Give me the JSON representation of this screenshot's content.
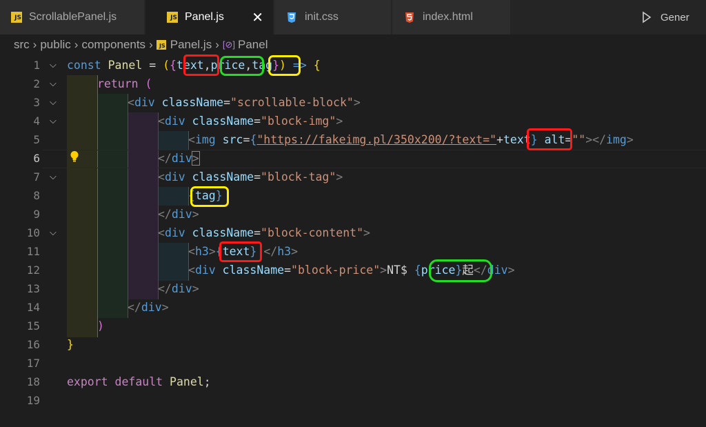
{
  "tabs": [
    {
      "label": "ScrollablePanel.js",
      "icon": "js-file-icon",
      "active": false
    },
    {
      "label": "Panel.js",
      "icon": "js-file-icon",
      "active": true
    },
    {
      "label": "init.css",
      "icon": "css-file-icon",
      "active": false
    },
    {
      "label": "index.html",
      "icon": "html-file-icon",
      "active": false
    }
  ],
  "close_glyph": "✕",
  "run_label": "Gener",
  "breadcrumb": {
    "items": [
      "src",
      "public",
      "components",
      "Panel.js",
      "Panel"
    ],
    "js_badge": "JS",
    "symbol_glyph": "[⊘]"
  },
  "editor": {
    "current_line": 6,
    "lines": [
      {
        "n": "1"
      },
      {
        "n": "2"
      },
      {
        "n": "3"
      },
      {
        "n": "4"
      },
      {
        "n": "5"
      },
      {
        "n": "6"
      },
      {
        "n": "7"
      },
      {
        "n": "8"
      },
      {
        "n": "9"
      },
      {
        "n": "10"
      },
      {
        "n": "11"
      },
      {
        "n": "12"
      },
      {
        "n": "13"
      },
      {
        "n": "14"
      },
      {
        "n": "15"
      },
      {
        "n": "16"
      },
      {
        "n": "17"
      },
      {
        "n": "18"
      },
      {
        "n": "19"
      }
    ],
    "code": {
      "l1_kw": "const",
      "l1_name": "Panel",
      "l1_eq": " = ",
      "l1_open": "(",
      "l1_brace": "{",
      "l1_p1": "text",
      "l1_c1": ",",
      "l1_p2": "price",
      "l1_c2": ",",
      "l1_p3": "tag",
      "l1_close_brace": "}",
      "l1_close": ")",
      "l1_arrow": " => ",
      "l1_body": "{",
      "l2_kw": "return",
      "l2_paren": " (",
      "l3_open": "<",
      "l3_tag": "div",
      "l3_attr": " className",
      "l3_eq": "=",
      "l3_val": "\"scrollable-block\"",
      "l3_close": ">",
      "l4_open": "<",
      "l4_tag": "div",
      "l4_attr": " className",
      "l4_eq": "=",
      "l4_val": "\"block-img\"",
      "l4_close": ">",
      "l5_open": "<",
      "l5_tag": "img",
      "l5_attr": " src",
      "l5_eq": "=",
      "l5_brace": "{",
      "l5_url": "\"https://fakeimg.pl/350x200/?text=\"",
      "l5_plus": "+",
      "l5_var": "text",
      "l5_rbrace": "}",
      "l5_alt": " alt",
      "l5_eq2": "=",
      "l5_altval": "\"\"",
      "l5_close": "></",
      "l5_tag2": "img",
      "l5_end": ">",
      "l6_open": "</",
      "l6_tag": "div",
      "l6_close": ">",
      "l7_open": "<",
      "l7_tag": "div",
      "l7_attr": " className",
      "l7_eq": "=",
      "l7_val": "\"block-tag\"",
      "l7_close": ">",
      "l8_brace": "{",
      "l8_var": "tag",
      "l8_rbrace": "}",
      "l9_open": "</",
      "l9_tag": "div",
      "l9_close": ">",
      "l10_open": "<",
      "l10_tag": "div",
      "l10_attr": " className",
      "l10_eq": "=",
      "l10_val": "\"block-content\"",
      "l10_close": ">",
      "l11_open": "<",
      "l11_tag": "h3",
      "l11_gt": ">",
      "l11_brace": "{",
      "l11_var": "text",
      "l11_rbrace": "}",
      "l11_close": "</",
      "l11_tag2": "h3",
      "l11_end": ">",
      "l12_open": "<",
      "l12_tag": "div",
      "l12_attr": " className",
      "l12_eq": "=",
      "l12_val": "\"block-price\"",
      "l12_gt": ">",
      "l12_text": "NT$ ",
      "l12_brace": "{",
      "l12_var": "price",
      "l12_rbrace": "}",
      "l12_suffix": "起",
      "l12_close": "</",
      "l12_tag2": "div",
      "l12_end": ">",
      "l13_open": "</",
      "l13_tag": "div",
      "l13_close": ">",
      "l14_open": "</",
      "l14_tag": "div",
      "l14_close": ">",
      "l15_paren": ")",
      "l16_brace": "}",
      "l18_kw1": "export",
      "l18_kw2": " default",
      "l18_name": " Panel",
      "l18_semi": ";"
    }
  },
  "colors": {
    "background": "#1e1e1e",
    "tabbar": "#252526",
    "keyword": "#569cd6",
    "control": "#c586c0",
    "function": "#dcdcaa",
    "string": "#ce9178",
    "variable": "#9cdcfe",
    "mark_red": "#ff1a1a",
    "mark_green": "#22dd22",
    "mark_yellow": "#ffee00"
  }
}
